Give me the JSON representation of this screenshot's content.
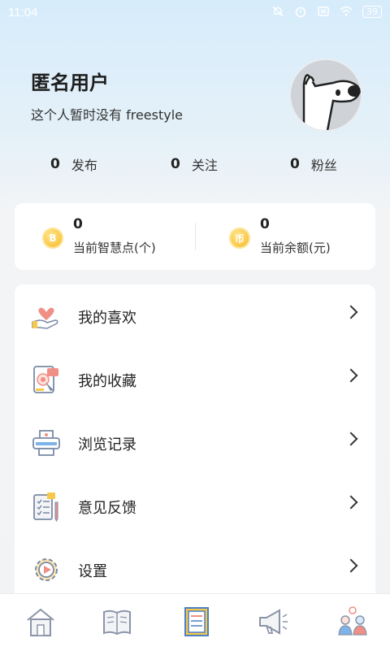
{
  "status_bar": {
    "time": "11:04",
    "battery": "39"
  },
  "profile": {
    "name": "匿名用户",
    "bio": "这个人暂时没有 freestyle"
  },
  "stats": [
    {
      "count": "0",
      "label": "发布"
    },
    {
      "count": "0",
      "label": "关注"
    },
    {
      "count": "0",
      "label": "粉丝"
    }
  ],
  "wallet": [
    {
      "value": "0",
      "label": "当前智慧点(个)",
      "coin_text": "B"
    },
    {
      "value": "0",
      "label": "当前余额(元)",
      "coin_text": "币"
    }
  ],
  "menu": [
    {
      "label": "我的喜欢",
      "icon": "heart-hand-icon"
    },
    {
      "label": "我的收藏",
      "icon": "tablet-favorite-icon"
    },
    {
      "label": "浏览记录",
      "icon": "printer-icon"
    },
    {
      "label": "意见反馈",
      "icon": "checklist-icon"
    },
    {
      "label": "设置",
      "icon": "settings-gear-icon"
    }
  ],
  "tabs": [
    {
      "icon": "home-icon"
    },
    {
      "icon": "book-icon"
    },
    {
      "icon": "notebook-icon"
    },
    {
      "icon": "megaphone-icon"
    },
    {
      "icon": "chat-people-icon"
    }
  ],
  "colors": {
    "accent_coin": "#f7b31c",
    "background_top": "#d6ecfb"
  }
}
